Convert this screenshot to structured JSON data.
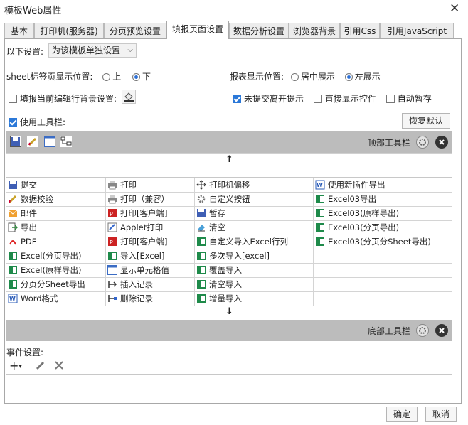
{
  "window": {
    "title": "模板Web属性",
    "close": "✕"
  },
  "tabs": [
    "基本",
    "打印机(服务器)",
    "分页预览设置",
    "填报页面设置",
    "数据分析设置",
    "浏览器背景",
    "引用Css",
    "引用JavaScript"
  ],
  "active_tab": "填报页面设置",
  "settings": {
    "scope_label": "以下设置:",
    "scope_value": "为该模板单独设置",
    "sheet_pos_label": "sheet标签页显示位置:",
    "sheet_pos_options": [
      "上",
      "下"
    ],
    "sheet_pos_selected": "下",
    "report_pos_label": "报表显示位置:",
    "report_pos_options": [
      "居中展示",
      "左展示"
    ],
    "report_pos_selected": "左展示",
    "fill_bg_label": "填报当前编辑行背景设置:",
    "unsubmitted_label": "未提交离开提示",
    "show_control_label": "直接显示控件",
    "autosave_label": "自动暂存",
    "use_toolbar_label": "使用工具栏:",
    "restore_default": "恢复默认"
  },
  "toolbar": {
    "top_label": "顶部工具栏",
    "bottom_label": "底部工具栏",
    "up_arrow": "↑",
    "down_arrow": "↓"
  },
  "buttons_grid": {
    "col1": [
      "提交",
      "数据校验",
      "邮件",
      "导出",
      "PDF",
      "Excel(分页导出)",
      "Excel(原样导出)",
      "分页分Sheet导出",
      "Word格式"
    ],
    "col2": [
      "打印",
      "打印（兼容）",
      "打印[客户端]",
      "Applet打印",
      "打印[客户端]",
      "导入[Excel]",
      "显示单元格值",
      "插入记录",
      "删除记录"
    ],
    "col3": [
      "打印机偏移",
      "自定义按钮",
      "暂存",
      "清空",
      "自定义导入Excel行列",
      "多次导入[excel]",
      "覆盖导入",
      "清空导入",
      "增量导入"
    ],
    "col4": [
      "使用新插件导出",
      "Excel03导出",
      "Excel03(原样导出)",
      "Excel03(分页导出)",
      "Excel03(分页分Sheet导出)"
    ]
  },
  "events": {
    "label": "事件设置:"
  },
  "footer": {
    "ok": "确定",
    "cancel": "取消"
  }
}
